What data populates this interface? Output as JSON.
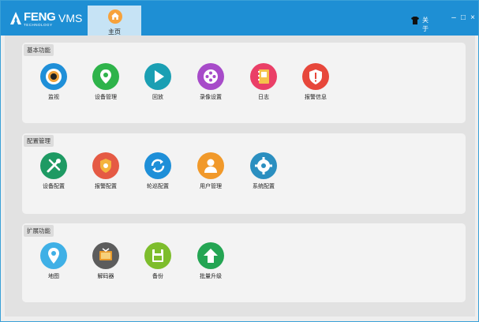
{
  "titlebar": {
    "logo_text": "FENG",
    "logo_sub": "TECHNOLOGY",
    "app_name": "VMS",
    "home_tab": "主页",
    "about": "关于",
    "minimize": "–",
    "restore": "□",
    "close": "×"
  },
  "sections": [
    {
      "title": "基本功能",
      "items": [
        {
          "label": "监视",
          "icon": "camera-icon",
          "color": "#1f8fd8"
        },
        {
          "label": "设备管理",
          "icon": "location-pin-icon",
          "color": "#2eb34a"
        },
        {
          "label": "回放",
          "icon": "play-icon",
          "color": "#1a9fb3"
        },
        {
          "label": "录像设置",
          "icon": "film-reel-icon",
          "color": "#a74bc9"
        },
        {
          "label": "日志",
          "icon": "log-book-icon",
          "color": "#ea3f67"
        },
        {
          "label": "报警信息",
          "icon": "alarm-shield-icon",
          "color": "#e7473b"
        }
      ]
    },
    {
      "title": "配置管理",
      "items": [
        {
          "label": "设备配置",
          "icon": "tools-icon",
          "color": "#1e9a63"
        },
        {
          "label": "报警配置",
          "icon": "alarm-config-icon",
          "color": "#e55a44"
        },
        {
          "label": "轮巡配置",
          "icon": "refresh-icon",
          "color": "#1e8fd8"
        },
        {
          "label": "用户管理",
          "icon": "user-icon",
          "color": "#f1992a"
        },
        {
          "label": "系统配置",
          "icon": "gear-icon",
          "color": "#2b8fc0"
        }
      ]
    },
    {
      "title": "扩展功能",
      "items": [
        {
          "label": "地图",
          "icon": "map-pin-icon",
          "color": "#3fb0e6"
        },
        {
          "label": "解码器",
          "icon": "tv-icon",
          "color": "#5c5c5c"
        },
        {
          "label": "备份",
          "icon": "save-icon",
          "color": "#7dbd2c"
        },
        {
          "label": "批量升级",
          "icon": "upload-arrow-icon",
          "color": "#24a553"
        }
      ]
    }
  ]
}
